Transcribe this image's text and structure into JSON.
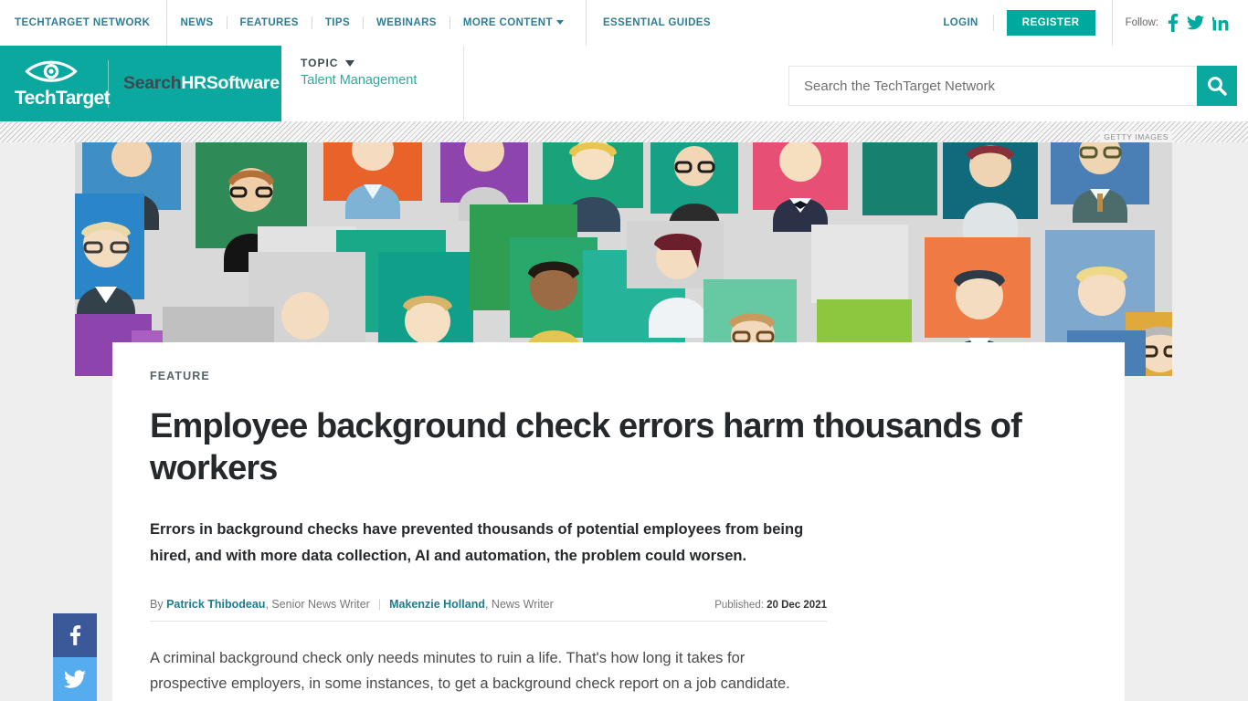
{
  "topnav": {
    "network_label": "TECHTARGET NETWORK",
    "links": [
      {
        "label": "NEWS",
        "name": "nav-news"
      },
      {
        "label": "FEATURES",
        "name": "nav-features"
      },
      {
        "label": "TIPS",
        "name": "nav-tips"
      },
      {
        "label": "WEBINARS",
        "name": "nav-webinars"
      },
      {
        "label": "MORE CONTENT",
        "name": "nav-more-content"
      }
    ],
    "essential_guides": "ESSENTIAL GUIDES",
    "login": "LOGIN",
    "register": "REGISTER",
    "follow_label": "Follow:",
    "social": [
      "facebook-icon",
      "twitter-icon",
      "linkedin-icon"
    ]
  },
  "masthead": {
    "logo_text": "TechTarget",
    "site_name_part1": "Search",
    "site_name_part2": "HRSoftware",
    "topic_label": "TOPIC",
    "topic_value": "Talent Management",
    "search_placeholder": "Search the TechTarget Network",
    "search_value": ""
  },
  "hero": {
    "credit": "GETTY IMAGES",
    "alt": "flat-design illustrated grid of diverse employee portrait avatars"
  },
  "article": {
    "kicker": "FEATURE",
    "headline": "Employee background check errors harm thousands of workers",
    "deck": "Errors in background checks have prevented thousands of potential employees from being hired, and with more data collection, AI and automation, the problem could worsen.",
    "byline_prefix": "By",
    "author1_name": "Patrick Thibodeau",
    "author1_title": ", Senior News Writer",
    "author2_name": "Makenzie Holland",
    "author2_title": ", News Writer",
    "published_label": "Published:",
    "published_date": "20 Dec 2021",
    "body_paragraph": "A criminal background check only needs minutes to ruin a life. That's how long it takes for prospective employers, in some instances, to get a background check report on a job candidate."
  },
  "share": {
    "facebook": "facebook-share-icon",
    "twitter": "twitter-share-icon"
  },
  "colors": {
    "brand_teal": "#0aa89e",
    "link_teal": "#2f7d95",
    "facebook_blue": "#3b5998",
    "twitter_blue": "#55acee",
    "headline_dark": "#26292b"
  }
}
